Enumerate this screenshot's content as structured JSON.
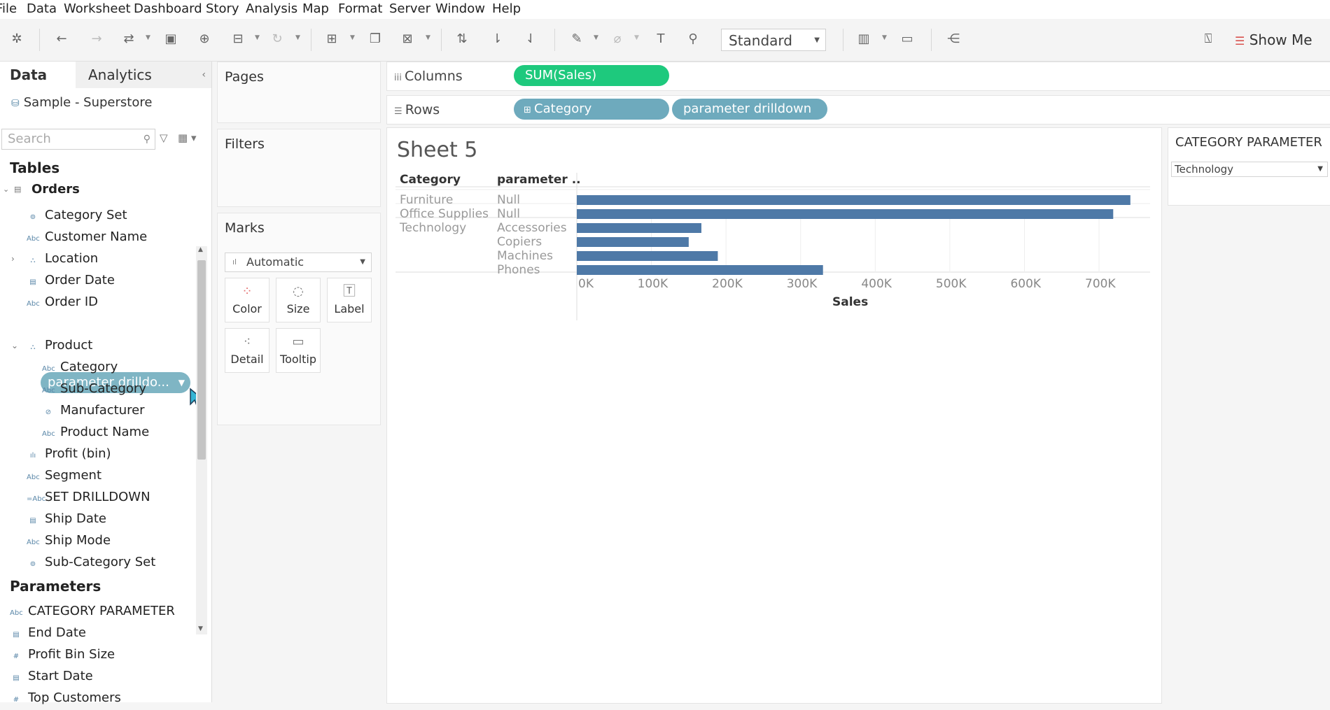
{
  "menu": [
    "File",
    "Data",
    "Worksheet",
    "Dashboard",
    "Story",
    "Analysis",
    "Map",
    "Format",
    "Server",
    "Window",
    "Help"
  ],
  "toolbar": {
    "fit_select": "Standard",
    "show_me": "Show Me"
  },
  "data_pane": {
    "tab_data": "Data",
    "tab_analytics": "Analytics",
    "datasource": "Sample - Superstore",
    "search_placeholder": "Search",
    "tables_header": "Tables",
    "table_name": "Orders",
    "fields": [
      {
        "label": "Category Set",
        "icon": "set-icon"
      },
      {
        "label": "Customer Name",
        "icon": "abc-icon"
      },
      {
        "label": "Location",
        "icon": "hierarchy-icon"
      },
      {
        "label": "Order Date",
        "icon": "calendar-icon"
      },
      {
        "label": "Order ID",
        "icon": "abc-icon"
      },
      {
        "label": "parameter drilldo...",
        "icon": "calc-abc-icon"
      },
      {
        "label": "Product",
        "icon": "hierarchy-icon"
      },
      {
        "label": "Category",
        "icon": "abc-icon"
      },
      {
        "label": "Sub-Category",
        "icon": "abc-icon"
      },
      {
        "label": "Manufacturer",
        "icon": "link-icon"
      },
      {
        "label": "Product Name",
        "icon": "abc-icon"
      },
      {
        "label": "Profit (bin)",
        "icon": "bin-icon"
      },
      {
        "label": "Segment",
        "icon": "abc-icon"
      },
      {
        "label": "SET DRILLDOWN",
        "icon": "calc-abc-icon"
      },
      {
        "label": "Ship Date",
        "icon": "calendar-icon"
      },
      {
        "label": "Ship Mode",
        "icon": "abc-icon"
      },
      {
        "label": "Sub-Category Set",
        "icon": "set-icon"
      }
    ],
    "parameters_header": "Parameters",
    "parameters": [
      {
        "label": "CATEGORY PARAMETER",
        "icon": "abc-icon"
      },
      {
        "label": "End Date",
        "icon": "calendar-icon"
      },
      {
        "label": "Profit Bin Size",
        "icon": "hash-icon"
      },
      {
        "label": "Start Date",
        "icon": "calendar-icon"
      },
      {
        "label": "Top Customers",
        "icon": "hash-icon"
      }
    ]
  },
  "cards": {
    "pages": "Pages",
    "filters": "Filters",
    "marks": "Marks",
    "marks_type": "Automatic",
    "mark_buttons": [
      "Color",
      "Size",
      "Label",
      "Detail",
      "Tooltip"
    ]
  },
  "shelves": {
    "columns_label": "Columns",
    "rows_label": "Rows",
    "columns_pills": [
      "SUM(Sales)"
    ],
    "rows_pills": [
      "Category",
      "parameter drilldown"
    ]
  },
  "view": {
    "sheet_title": "Sheet 5",
    "col_headers": [
      "Category",
      "parameter .."
    ]
  },
  "category_parameter": {
    "title": "CATEGORY PARAMETER",
    "value": "Technology"
  },
  "chart_data": {
    "type": "bar",
    "orientation": "horizontal",
    "rows": [
      {
        "category": "Furniture",
        "sub": "Null",
        "value": 742000
      },
      {
        "category": "Office Supplies",
        "sub": "Null",
        "value": 719000
      },
      {
        "category": "Technology",
        "sub": "Accessories",
        "value": 167000
      },
      {
        "category": "Technology",
        "sub": "Copiers",
        "value": 150000
      },
      {
        "category": "Technology",
        "sub": "Machines",
        "value": 189000
      },
      {
        "category": "Technology",
        "sub": "Phones",
        "value": 330000
      }
    ],
    "xlabel": "Sales",
    "xticks": [
      "0K",
      "100K",
      "200K",
      "300K",
      "400K",
      "500K",
      "600K",
      "700K"
    ],
    "xlim": [
      0,
      760000
    ],
    "bar_color": "#4e79a7"
  },
  "colors": {
    "measure_pill": "#1ec97d",
    "dimension_pill": "#6eaabd"
  }
}
